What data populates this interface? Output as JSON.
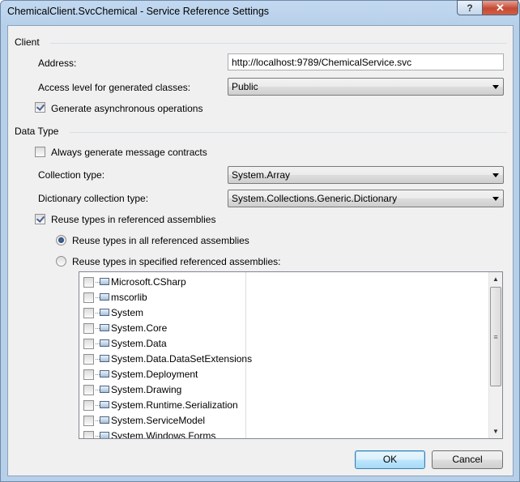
{
  "window": {
    "title": "ChemicalClient.SvcChemical - Service Reference Settings",
    "help_glyph": "?",
    "close_glyph": "✕"
  },
  "client": {
    "section_label": "Client",
    "address_label": "Address:",
    "address_value": "http://localhost:9789/ChemicalService.svc",
    "access_level_label": "Access level for generated classes:",
    "access_level_value": "Public",
    "generate_async_label": "Generate asynchronous operations",
    "generate_async_checked": true
  },
  "data_type": {
    "section_label": "Data Type",
    "always_generate_label": "Always generate message contracts",
    "always_generate_checked": false,
    "collection_type_label": "Collection type:",
    "collection_type_value": "System.Array",
    "dictionary_type_label": "Dictionary collection type:",
    "dictionary_type_value": "System.Collections.Generic.Dictionary",
    "reuse_types_label": "Reuse types in referenced assemblies",
    "reuse_types_checked": true,
    "reuse_all_label": "Reuse types in all referenced assemblies",
    "reuse_specified_label": "Reuse types in specified referenced assemblies:",
    "selected_reuse_option": "all"
  },
  "assemblies": [
    {
      "label": "Microsoft.CSharp",
      "checked": false
    },
    {
      "label": "mscorlib",
      "checked": false
    },
    {
      "label": "System",
      "checked": false
    },
    {
      "label": "System.Core",
      "checked": false
    },
    {
      "label": "System.Data",
      "checked": false
    },
    {
      "label": "System.Data.DataSetExtensions",
      "checked": false
    },
    {
      "label": "System.Deployment",
      "checked": false
    },
    {
      "label": "System.Drawing",
      "checked": false
    },
    {
      "label": "System.Runtime.Serialization",
      "checked": false
    },
    {
      "label": "System.ServiceModel",
      "checked": false
    },
    {
      "label": "System.Windows.Forms",
      "checked": false
    }
  ],
  "footer": {
    "ok_label": "OK",
    "cancel_label": "Cancel"
  },
  "colors": {
    "title_bar": "#b7d0ea",
    "dialog_background": "#f0f0f0",
    "close_button": "#c44a34",
    "default_button_border": "#3c7fb1"
  }
}
